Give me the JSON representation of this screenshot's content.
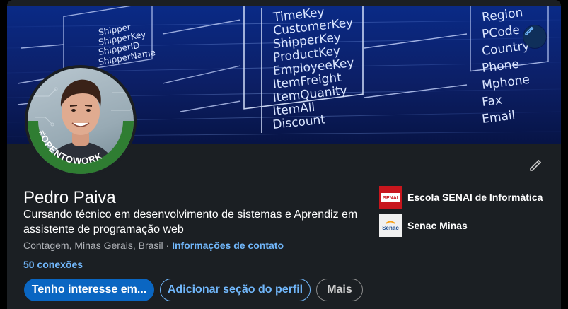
{
  "banner": {
    "fields_center": [
      "TimeKey",
      "CustomerKey",
      "ShipperKey",
      "ProductKey",
      "EmployeeKey",
      "ItemFreight",
      "ItemQuanity",
      "ItemAll",
      "Discount"
    ],
    "fields_left": [
      "Shipper",
      "ShipperKey",
      "ShipperID",
      "ShipperName"
    ],
    "fields_right": [
      "Region",
      "PCode",
      "Country",
      "Phone",
      "Mphone",
      "Fax",
      "Email"
    ]
  },
  "profile": {
    "avatar_badge": "#OPENTOWORK",
    "name": "Pedro Paiva",
    "headline": "Cursando técnico em desenvolvimento de sistemas e Aprendiz em assistente de programação web",
    "location": "Contagem, Minas Gerais, Brasil",
    "separator": " · ",
    "contact_link": "Informações de contato",
    "connections": "50 conexões"
  },
  "actions": {
    "primary": "Tenho interesse em...",
    "add_section": "Adicionar seção do perfil",
    "more": "Mais"
  },
  "education": [
    {
      "name": "Escola SENAI de Informática",
      "logo_text": "SENAI",
      "logo_color": "#c8161d"
    },
    {
      "name": "Senac Minas",
      "logo_text": "Senac",
      "logo_color": "#f0f0f0"
    }
  ],
  "colors": {
    "accent": "#0a66c2",
    "link": "#71b7fb",
    "card": "#1b1f23",
    "open_to_work": "#2f7d32"
  },
  "icons": {
    "banner_edit": "pencil-icon",
    "profile_edit": "pencil-icon"
  }
}
